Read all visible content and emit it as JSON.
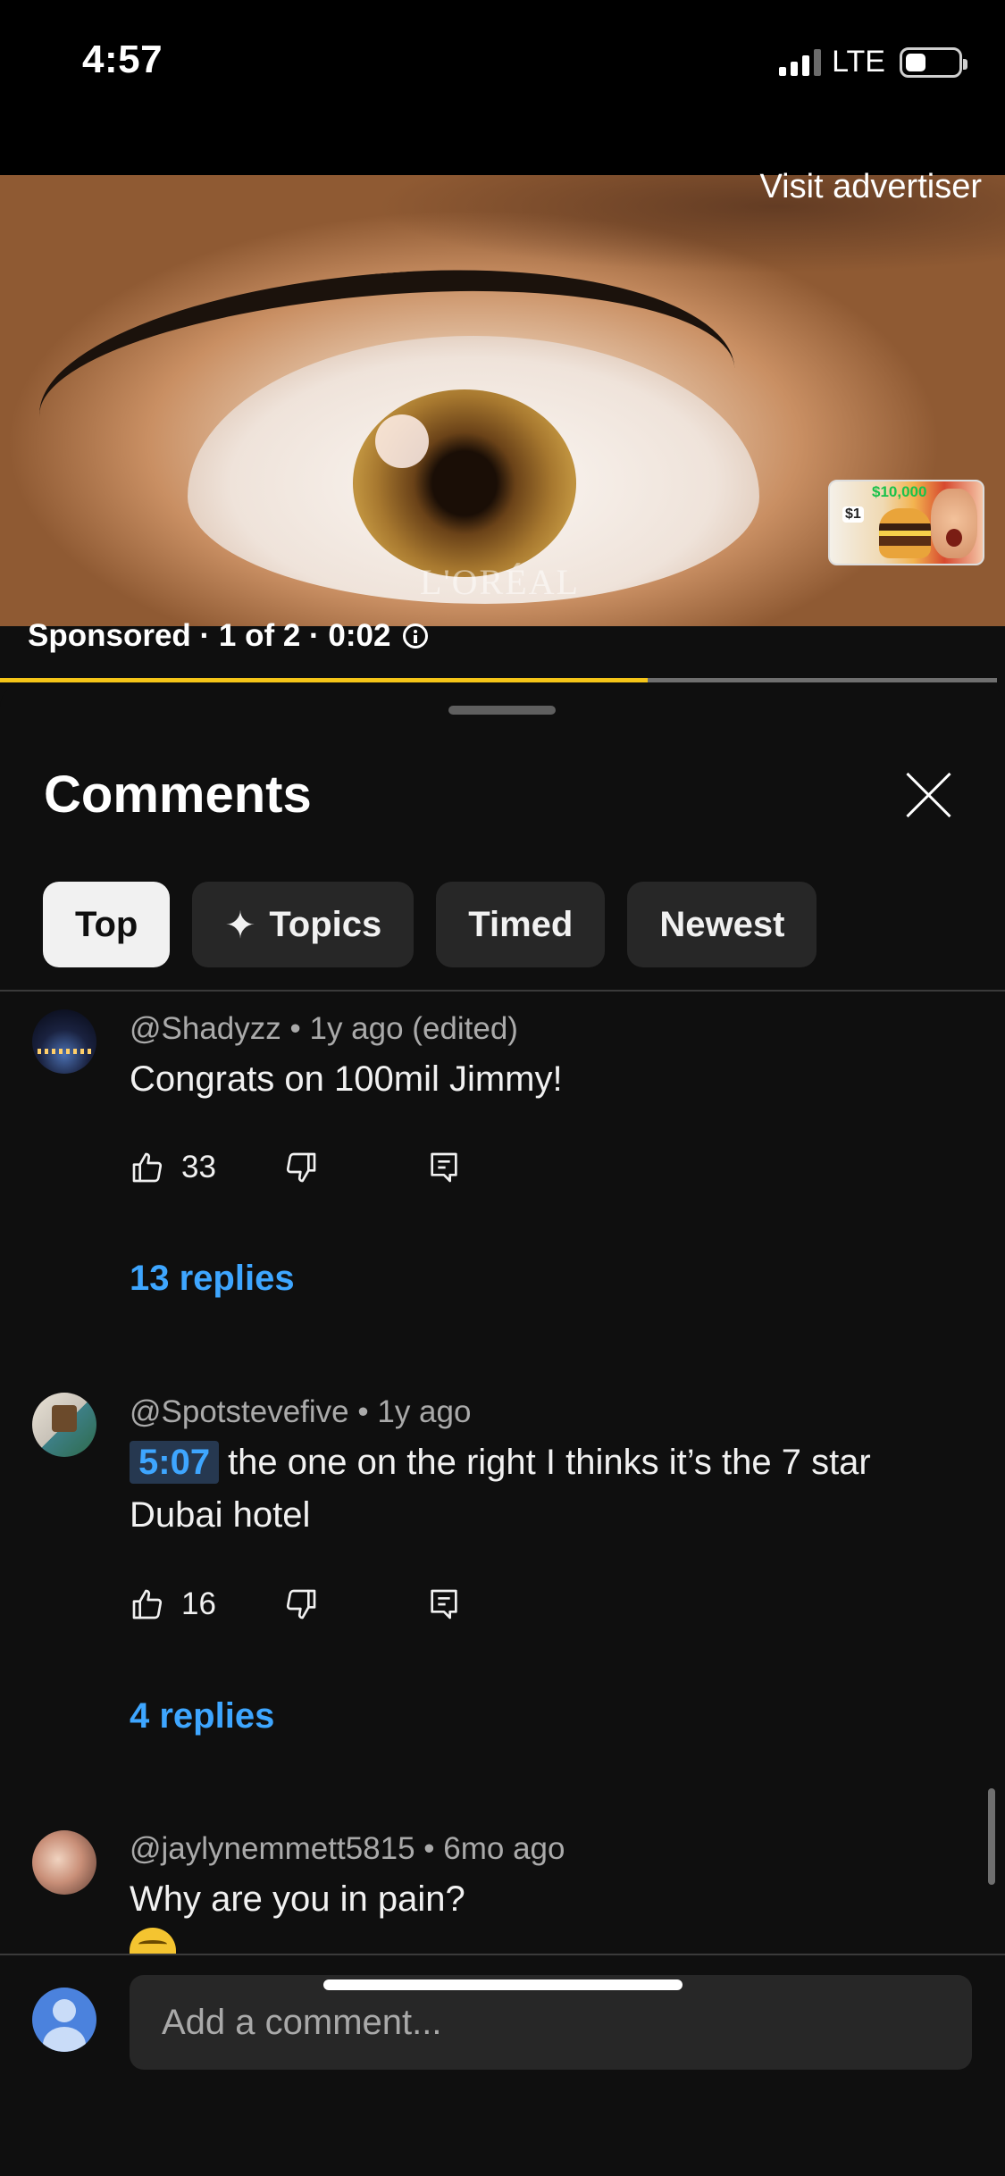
{
  "status_bar": {
    "time": "4:57",
    "network": "LTE",
    "signal_bars_active": 3,
    "battery_level": 0.3
  },
  "ad": {
    "visit_label": "Visit advertiser",
    "brand_watermark": "L'ORÉAL",
    "thumbnail": {
      "price_top": "$10,000",
      "price_small": "$1"
    },
    "sponsored_label": "Sponsored · 1 of 2 · 0:02",
    "progress": 0.65,
    "progress_color": "#f5c518"
  },
  "comments_sheet": {
    "title": "Comments",
    "chips": [
      {
        "label": "Top",
        "active": true
      },
      {
        "label": "Topics",
        "icon": "sparkle-icon",
        "active": false
      },
      {
        "label": "Timed",
        "active": false
      },
      {
        "label": "Newest",
        "active": false
      }
    ],
    "comments": [
      {
        "author": "@Shadyzz",
        "age": "1y ago (edited)",
        "text": "Congrats on 100mil Jimmy!",
        "likes": "33",
        "replies": "13 replies"
      },
      {
        "author": "@Spotstevefive",
        "age": "1y ago",
        "timestamp": "5:07",
        "text": "the one on the right I thinks it’s the 7 star Dubai hotel",
        "likes": "16",
        "replies": "4 replies"
      },
      {
        "author": "@jaylynemmett5815",
        "age": "6mo ago",
        "text": "Why are you in pain?"
      }
    ],
    "composer": {
      "placeholder": "Add a comment..."
    }
  },
  "colors": {
    "background": "#0f0f0f",
    "chip_bg": "#272727",
    "link_blue": "#3ea6ff",
    "meta_gray": "#aaaaaa"
  }
}
